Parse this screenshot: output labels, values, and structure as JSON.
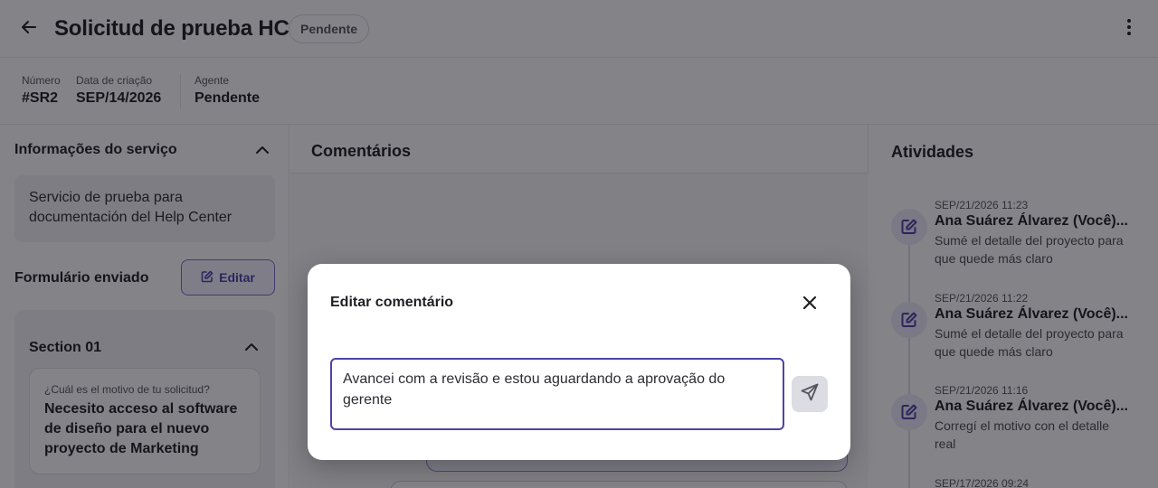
{
  "header": {
    "title": "Solicitud de prueba HC",
    "status": "Pendente"
  },
  "meta": {
    "number_label": "Número",
    "number_value": "#SR2",
    "date_label": "Data de criação",
    "date_value": "SEP/14/2026",
    "agent_label": "Agente",
    "agent_value": "Pendente"
  },
  "left": {
    "service_title": "Informações do serviço",
    "service_description": "Servicio de prueba para documentación del Help Center",
    "form_title": "Formulário enviado",
    "edit_label": "Editar",
    "section_title": "Section 01",
    "question": "¿Cuál es el motivo de tu solicitud?",
    "answer": "Necesito acceso al software de diseño para el nuevo proyecto de Marketing"
  },
  "comments": {
    "title": "Comentários"
  },
  "activities": {
    "title": "Atividades",
    "items": [
      {
        "time": "SEP/21/2026 11:23",
        "author": "Ana Suárez Álvarez (Você)...",
        "text": "Sumé el detalle del proyecto para que quede más claro"
      },
      {
        "time": "SEP/21/2026 11:22",
        "author": "Ana Suárez Álvarez (Você)...",
        "text": "Sumé el detalle del proyecto para que quede más claro"
      },
      {
        "time": "SEP/21/2026 11:16",
        "author": "Ana Suárez Álvarez (Você)...",
        "text": "Corregí el motivo con el detalle real"
      },
      {
        "time": "SEP/17/2026 09:24",
        "author": "",
        "text": ""
      }
    ]
  },
  "modal": {
    "title": "Editar comentário",
    "comment_value": "Avancei com a revisão e estou aguardando a aprovação do gerente"
  },
  "icons": {
    "back": "arrow-left-icon",
    "more": "more-vertical-icon",
    "chevron": "chevron-up-icon",
    "edit": "pencil-square-icon",
    "close": "close-icon",
    "send": "send-icon"
  },
  "colors": {
    "accent": "#4e43a8",
    "overlay": "rgba(10,10,18,0.5)"
  }
}
